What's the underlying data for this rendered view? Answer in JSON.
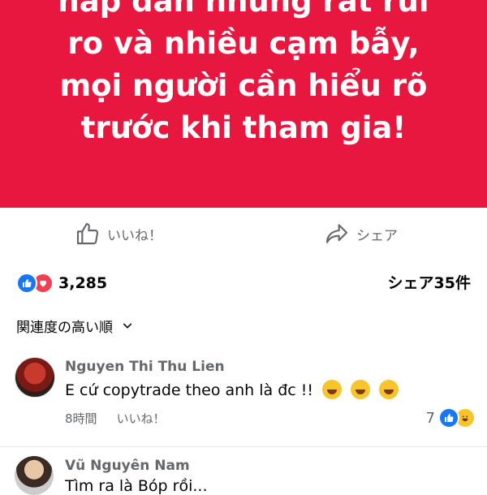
{
  "banner": {
    "lines": [
      "hấp dẫn nhưng rất rủi",
      "ro và nhiều cạm bẫy,",
      "mọi người cần hiểu rõ",
      "trước khi tham gia!"
    ],
    "background": "#e8173f"
  },
  "actions": {
    "like_label": "いいね！",
    "share_label": "シェア"
  },
  "reactions": {
    "count": "3,285",
    "shares": "シェア35件",
    "icons": [
      "like-icon",
      "love-icon"
    ]
  },
  "sort": {
    "label": "関連度の高い順"
  },
  "comments": [
    {
      "author": "Nguyen Thi Thu Lien",
      "text": "E cứ copytrade theo anh là đc !!",
      "emojis": [
        "rolling-laugh-emoji",
        "rolling-laugh-emoji",
        "rolling-laugh-emoji"
      ],
      "time": "8時間",
      "like_label": "いいね！",
      "reaction_count": "7",
      "reaction_icons": [
        "like-icon",
        "haha-icon"
      ]
    },
    {
      "author": "Vũ Nguyên Nam",
      "text": "Tìm ra là Bóp rồi..."
    }
  ],
  "colors": {
    "accent": "#1877f2",
    "love": "#f33e58",
    "secondary_text": "#65676b"
  }
}
